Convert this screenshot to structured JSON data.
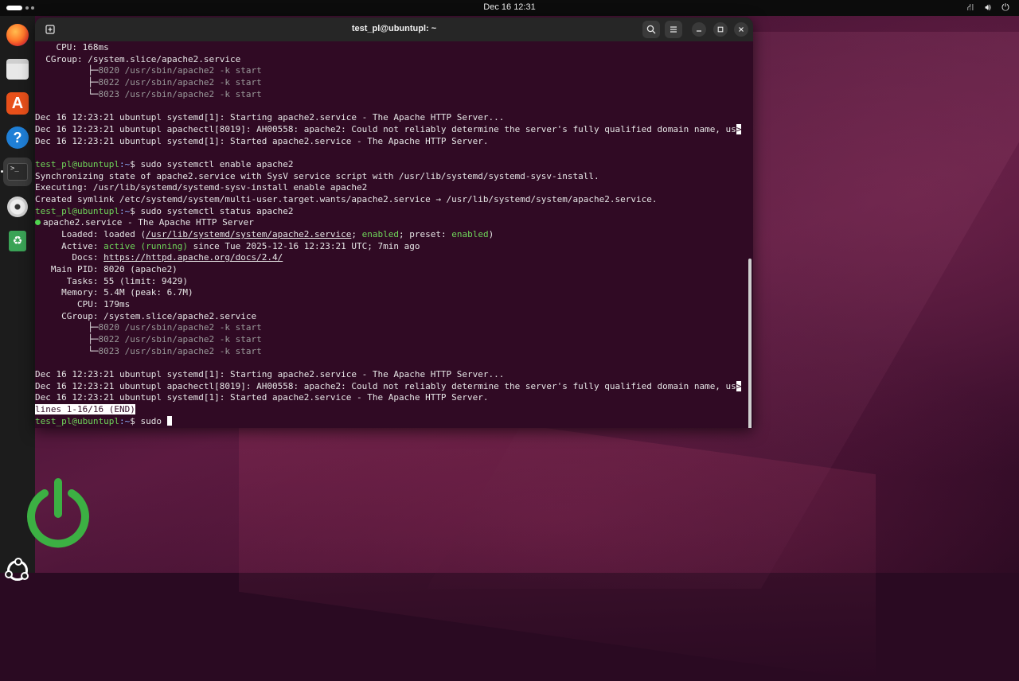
{
  "topbar": {
    "clock": "Dec 16  12:31"
  },
  "dock": {
    "items": [
      {
        "name": "Firefox"
      },
      {
        "name": "Files"
      },
      {
        "name": "App Center",
        "glyph": "A"
      },
      {
        "name": "Help",
        "glyph": "?"
      },
      {
        "name": "Terminal",
        "glyph": ">_"
      },
      {
        "name": "Disc"
      },
      {
        "name": "Trash",
        "glyph": "♻"
      }
    ]
  },
  "window": {
    "title": "test_pl@ubuntupl: ~"
  },
  "terminal": {
    "prompt_user": "test_pl@ubuntupl",
    "prompt_path": ":~",
    "prompt_sym": "$ ",
    "lines": {
      "l0": "    CPU: 168ms",
      "l1": "  CGroup: /system.slice/apache2.service",
      "l2a": "          ├─",
      "l2b": "8020 /usr/sbin/apache2 -k start",
      "l3a": "          ├─",
      "l3b": "8022 /usr/sbin/apache2 -k start",
      "l4a": "          └─",
      "l4b": "8023 /usr/sbin/apache2 -k start",
      "l6": "Dec 16 12:23:21 ubuntupl systemd[1]: Starting apache2.service - The Apache HTTP Server...",
      "l7": "Dec 16 12:23:21 ubuntupl apachectl[8019]: AH00558: apache2: Could not reliably determine the server's fully qualified domain name, us",
      "l7end": ">",
      "l8": "Dec 16 12:23:21 ubuntupl systemd[1]: Started apache2.service - The Apache HTTP Server.",
      "cmd1": "sudo systemctl enable apache2",
      "l11": "Synchronizing state of apache2.service with SysV service script with /usr/lib/systemd/systemd-sysv-install.",
      "l12": "Executing: /usr/lib/systemd/systemd-sysv-install enable apache2",
      "l13": "Created symlink /etc/systemd/system/multi-user.target.wants/apache2.service → /usr/lib/systemd/system/apache2.service.",
      "cmd2": "sudo systemctl status apache2",
      "svc_name": "apache2.service - The Apache HTTP Server",
      "loaded_pre": "     Loaded: loaded (",
      "loaded_path": "/usr/lib/systemd/system/apache2.service",
      "loaded_sep": "; ",
      "loaded_enabled": "enabled",
      "loaded_preset": "; preset: ",
      "loaded_preset_val": "enabled",
      "loaded_close": ")",
      "active_pre": "     Active: ",
      "active_state": "active (running)",
      "active_post": " since Tue 2025-12-16 12:23:21 UTC; 7min ago",
      "docs_pre": "       Docs: ",
      "docs_url": "https://httpd.apache.org/docs/2.4/",
      "mainpid": "   Main PID: 8020 (apache2)",
      "tasks": "      Tasks: 55 (limit: 9429)",
      "memory": "     Memory: 5.4M (peak: 6.7M)",
      "cpu2": "        CPU: 179ms",
      "cgroup2": "     CGroup: /system.slice/apache2.service",
      "lines_end": "lines 1-16/16 (END)",
      "cmd3": "sudo "
    }
  }
}
